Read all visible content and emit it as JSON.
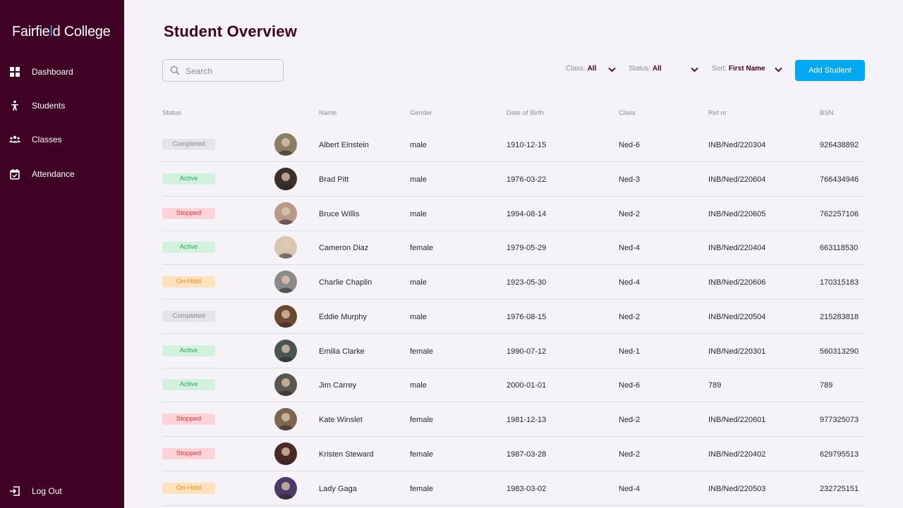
{
  "brand": {
    "name_part1": "Fairfie",
    "name_accent": "l",
    "name_part2": "d College"
  },
  "sidebar": {
    "items": [
      {
        "label": "Dashboard",
        "icon": "grid-icon"
      },
      {
        "label": "Students",
        "icon": "person-icon"
      },
      {
        "label": "Classes",
        "icon": "group-icon"
      },
      {
        "label": "Attendance",
        "icon": "calendar-check-icon"
      }
    ],
    "logout_label": "Log Out"
  },
  "page": {
    "title": "Student Overview"
  },
  "search": {
    "placeholder": "Search",
    "value": ""
  },
  "filters": {
    "class": {
      "label": "Class:",
      "value": "All"
    },
    "status": {
      "label": "Status:",
      "value": "All"
    },
    "sort": {
      "label": "Sort:",
      "value": "First Name"
    }
  },
  "toolbar": {
    "add_label": "Add Student"
  },
  "colors": {
    "sidebar_bg": "#3f0124",
    "accent_blue": "#02a9f0",
    "completed": "#e6e4e8",
    "active": "#d3f1df",
    "stopped": "#fcd3d6",
    "onhold": "#fee2bd"
  },
  "table": {
    "headers": [
      "Status",
      "Name",
      "Gender",
      "Date of Birth",
      "Class",
      "Ref nr",
      "BSN"
    ],
    "rows": [
      {
        "status": "Completed",
        "status_kind": "completed",
        "name": "Albert Einstein",
        "gender": "male",
        "dob": "1910-12-15",
        "class": "Ned-6",
        "ref": "INB/Ned/220304",
        "bsn": "926438892",
        "avatar_color": "#8b7d63"
      },
      {
        "status": "Active",
        "status_kind": "active",
        "name": "Brad Pitt",
        "gender": "male",
        "dob": "1976-03-22",
        "class": "Ned-3",
        "ref": "INB/Ned/220604",
        "bsn": "766434946",
        "avatar_color": "#3a2f2a"
      },
      {
        "status": "Stopped",
        "status_kind": "stopped",
        "name": "Bruce Willis",
        "gender": "male",
        "dob": "1994-08-14",
        "class": "Ned-2",
        "ref": "INB/Ned/220605",
        "bsn": "762257106",
        "avatar_color": "#b89a8a"
      },
      {
        "status": "Active",
        "status_kind": "active",
        "name": "Cameron Diaz",
        "gender": "female",
        "dob": "1979-05-29",
        "class": "Ned-4",
        "ref": "INB/Ned/220404",
        "bsn": "663118530",
        "avatar_color": "#d8c6b0"
      },
      {
        "status": "On-Hold",
        "status_kind": "onhold",
        "name": "Charlie Chaplin",
        "gender": "male",
        "dob": "1923-05-30",
        "class": "Ned-4",
        "ref": "INB/Ned/220606",
        "bsn": "170315183",
        "avatar_color": "#8a8a8a"
      },
      {
        "status": "Completed",
        "status_kind": "completed",
        "name": "Eddie Murphy",
        "gender": "male",
        "dob": "1976-08-15",
        "class": "Ned-2",
        "ref": "INB/Ned/220504",
        "bsn": "215283818",
        "avatar_color": "#6b4a32"
      },
      {
        "status": "Active",
        "status_kind": "active",
        "name": "Emilia Clarke",
        "gender": "female",
        "dob": "1990-07-12",
        "class": "Ned-1",
        "ref": "INB/Ned/220301",
        "bsn": "560313290",
        "avatar_color": "#4a5450"
      },
      {
        "status": "Active",
        "status_kind": "active",
        "name": "Jim Carrey",
        "gender": "male",
        "dob": "2000-01-01",
        "class": "Ned-6",
        "ref": "789",
        "bsn": "789",
        "avatar_color": "#5c5650"
      },
      {
        "status": "Stopped",
        "status_kind": "stopped",
        "name": "Kate Winslet",
        "gender": "female",
        "dob": "1981-12-13",
        "class": "Ned-2",
        "ref": "INB/Ned/220601",
        "bsn": "977325073",
        "avatar_color": "#7d6650"
      },
      {
        "status": "Stopped",
        "status_kind": "stopped",
        "name": "Kristen Steward",
        "gender": "female",
        "dob": "1987-03-28",
        "class": "Ned-2",
        "ref": "INB/Ned/220402",
        "bsn": "629795513",
        "avatar_color": "#4a2a24"
      },
      {
        "status": "On-Hold",
        "status_kind": "onhold",
        "name": "Lady Gaga",
        "gender": "female",
        "dob": "1983-03-02",
        "class": "Ned-4",
        "ref": "INB/Ned/220503",
        "bsn": "232725151",
        "avatar_color": "#4b3a68"
      }
    ]
  }
}
